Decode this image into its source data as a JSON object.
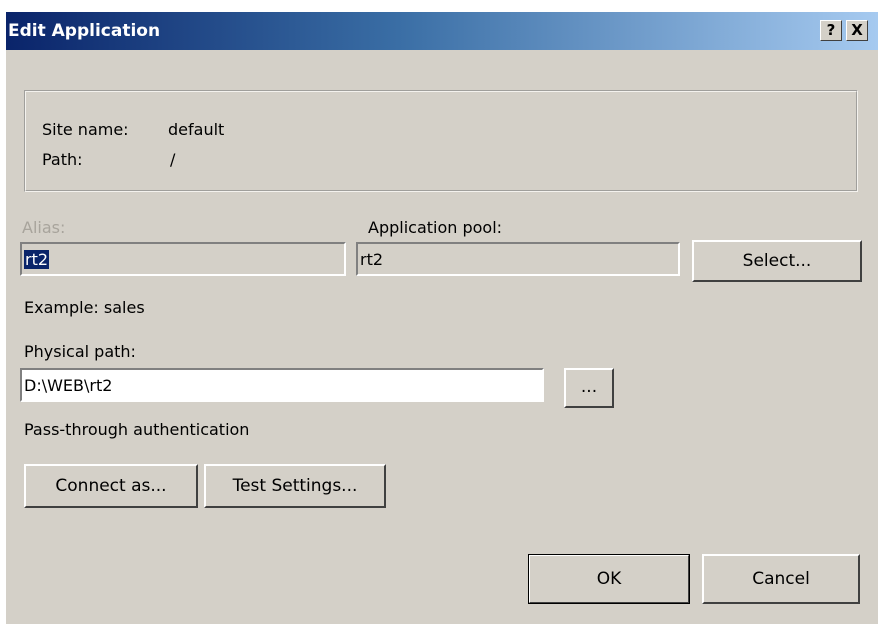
{
  "window": {
    "title": "Edit Application",
    "help_label": "?",
    "close_label": "X"
  },
  "site_info": {
    "site_name_label": "Site name:",
    "site_name_value": "default",
    "path_label": "Path:",
    "path_value": "/"
  },
  "alias": {
    "label": "Alias:",
    "value": "rt2",
    "example": "Example: sales"
  },
  "app_pool": {
    "label": "Application pool:",
    "value": "rt2",
    "select_label": "Select..."
  },
  "physical_path": {
    "label": "Physical path:",
    "value": "D:\\WEB\\rt2",
    "browse_label": "..."
  },
  "auth": {
    "label": "Pass-through authentication",
    "connect_as_label": "Connect as...",
    "test_settings_label": "Test Settings..."
  },
  "footer": {
    "ok_label": "OK",
    "cancel_label": "Cancel"
  }
}
